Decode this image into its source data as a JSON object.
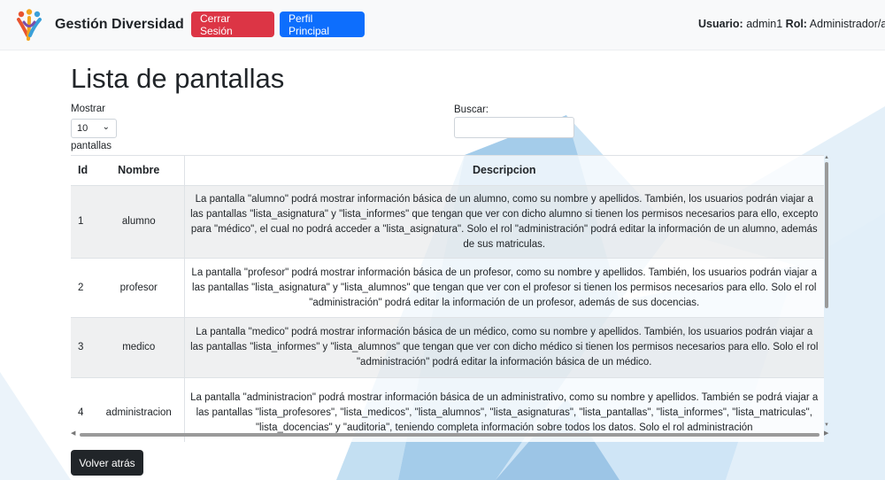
{
  "navbar": {
    "brand": "Gestión Diversidad",
    "logout_label": "Cerrar Sesión",
    "profile_label": "Perfil Principal",
    "user_label": "Usuario:",
    "user_value": "admin1",
    "role_label": "Rol:",
    "role_value": "Administrador/a"
  },
  "page": {
    "title": "Lista de pantallas",
    "show_label": "Mostrar",
    "show_value": "10",
    "show_suffix": "pantallas",
    "search_label": "Buscar:",
    "search_value": "",
    "back_label": "Volver atrás"
  },
  "table": {
    "headers": {
      "id": "Id",
      "nombre": "Nombre",
      "descripcion": "Descripcion"
    },
    "rows": [
      {
        "id": "1",
        "nombre": "alumno",
        "descripcion": "La pantalla \"alumno\" podrá mostrar información básica de un alumno, como su nombre y apellidos. También, los usuarios podrán viajar a las pantallas \"lista_asignatura\" y \"lista_informes\" que tengan que ver con dicho alumno si tienen los permisos necesarios para ello, excepto para \"médico\", el cual no podrá acceder a \"lista_asignatura\". Solo el rol \"administración\" podrá editar la información de un alumno, además de sus matriculas."
      },
      {
        "id": "2",
        "nombre": "profesor",
        "descripcion": "La pantalla \"profesor\" podrá mostrar información básica de un profesor, como su nombre y apellidos. También, los usuarios podrán viajar a las pantallas \"lista_asignatura\" y \"lista_alumnos\" que tengan que ver con el profesor si tienen los permisos necesarios para ello. Solo el rol \"administración\" podrá editar la información de un profesor, además de sus docencias."
      },
      {
        "id": "3",
        "nombre": "medico",
        "descripcion": "La pantalla \"medico\" podrá mostrar información básica de un médico, como su nombre y apellidos. También, los usuarios podrán viajar a las pantallas \"lista_informes\" y \"lista_alumnos\" que tengan que ver con dicho médico si tienen los permisos necesarios para ello. Solo el rol \"administración\" podrá editar la información básica de un médico."
      },
      {
        "id": "4",
        "nombre": "administracion",
        "descripcion": "La pantalla \"administracion\" podrá mostrar información básica de un administrativo, como su nombre y apellidos. También se podrá viajar a las pantallas \"lista_profesores\", \"lista_medicos\", \"lista_alumnos\", \"lista_asignaturas\", \"lista_pantallas\", \"lista_informes\", \"lista_matriculas\", \"lista_docencias\" y \"auditoria\", teniendo completa información sobre todos los datos. Solo el rol administración"
      }
    ]
  },
  "colors": {
    "danger": "#dc3545",
    "primary": "#0d6efd",
    "dark": "#212529"
  },
  "icons": {
    "logo": "people-logo-icon",
    "select": "chevron-down-icon"
  }
}
